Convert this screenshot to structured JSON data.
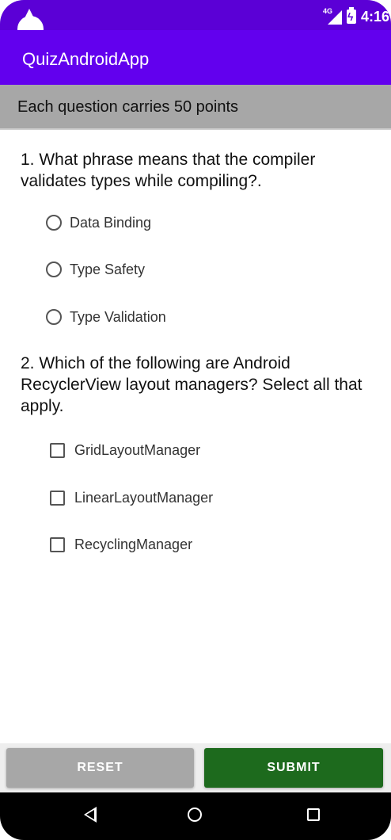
{
  "status_bar": {
    "network_label": "4G",
    "time": "4:16"
  },
  "app_bar": {
    "title": "QuizAndroidApp",
    "color": "#6200ee"
  },
  "info_banner": {
    "text": "Each question carries 50 points"
  },
  "questions": [
    {
      "text": "1. What phrase means that the compiler validates types while compiling?.",
      "type": "radio",
      "options": [
        "Data Binding",
        "Type Safety",
        "Type Validation"
      ]
    },
    {
      "text": "2. Which of the following are Android RecyclerView layout managers? Select all that apply.",
      "type": "checkbox",
      "options": [
        "GridLayoutManager",
        "LinearLayoutManager",
        "RecyclingManager"
      ]
    }
  ],
  "buttons": {
    "reset_label": "RESET",
    "submit_label": "SUBMIT",
    "reset_color": "#a7a7a7",
    "submit_color": "#1d6a1d"
  },
  "nav_bar": {
    "icons": [
      "back-icon",
      "home-icon",
      "recents-icon"
    ]
  }
}
